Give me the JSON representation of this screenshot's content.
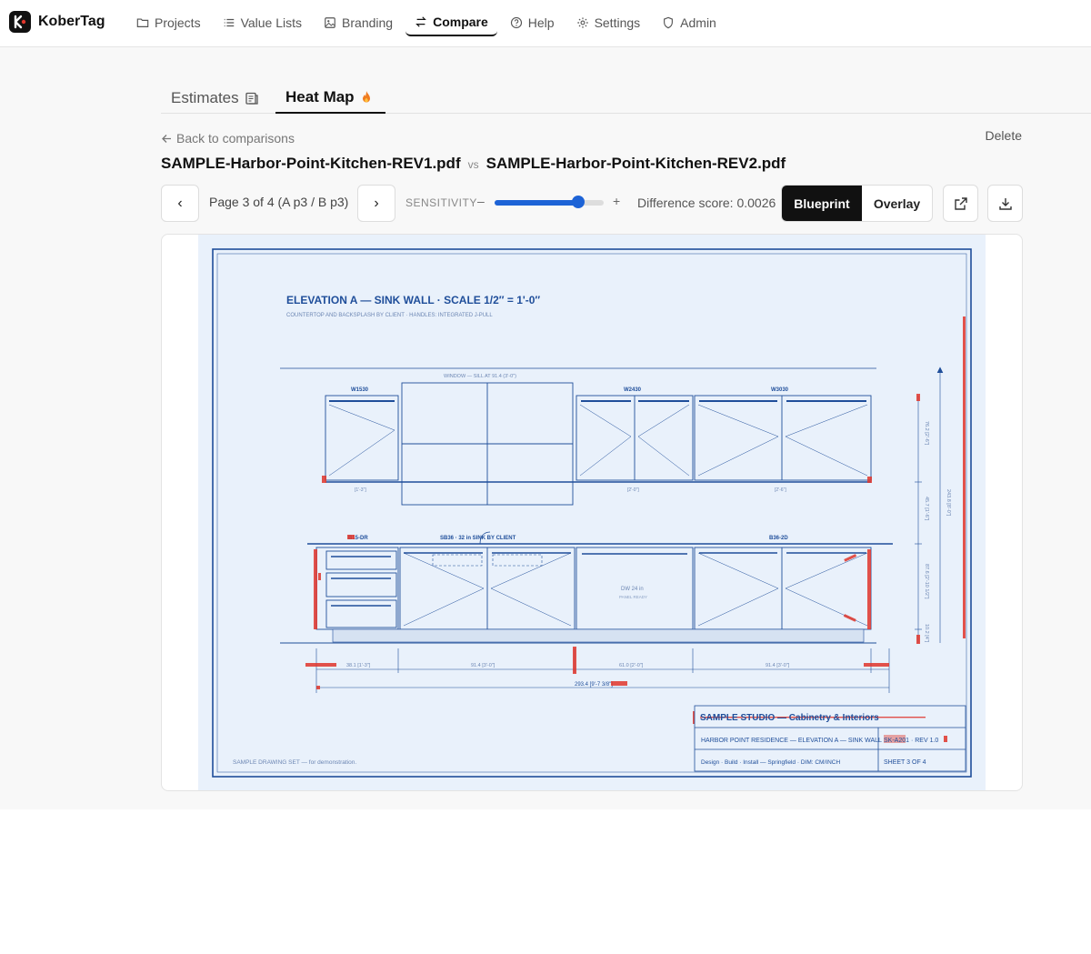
{
  "app": {
    "name": "KoberTag"
  },
  "nav": [
    {
      "label": "Projects",
      "icon": "folder-icon"
    },
    {
      "label": "Value Lists",
      "icon": "list-icon"
    },
    {
      "label": "Branding",
      "icon": "image-icon"
    },
    {
      "label": "Compare",
      "icon": "compare-arrows-icon",
      "active": true
    },
    {
      "label": "Help",
      "icon": "help-circle-icon"
    },
    {
      "label": "Settings",
      "icon": "gear-icon"
    },
    {
      "label": "Admin",
      "icon": "shield-icon"
    }
  ],
  "tabs": {
    "estimates": {
      "label": "Estimates",
      "icon": "document-icon"
    },
    "heatmap": {
      "label": "Heat Map",
      "icon": "flame-icon",
      "active": true
    }
  },
  "header": {
    "back_label": "Back to comparisons",
    "delete_label": "Delete",
    "file_a": "SAMPLE-Harbor-Point-Kitchen-REV1.pdf",
    "vs": "vs",
    "file_b": "SAMPLE-Harbor-Point-Kitchen-REV2.pdf"
  },
  "controls": {
    "prev_label": "‹",
    "next_label": "›",
    "page_label": "Page 3 of 4 (A p3 / B p3)",
    "sensitivity_label": "SENSITIVITY",
    "sensitivity_minus": "–",
    "sensitivity_plus": "+",
    "sensitivity_level": 0.77,
    "difference_label": "Difference score: 0.0026",
    "mode_blueprint": "Blueprint",
    "mode_overlay": "Overlay",
    "mode_selected": "Blueprint"
  },
  "drawing": {
    "title": "ELEVATION A — SINK WALL · SCALE 1/2″ = 1'-0″",
    "subtitle": "COUNTERTOP AND BACKSPLASH BY CLIENT · HANDLES: INTEGRATED J-PULL",
    "window_label": "WINDOW — SILL AT 91.4 (3'-0\")",
    "upper_labels": [
      "W1530",
      "W2430",
      "W3030"
    ],
    "lower_labels": [
      "B15-DR",
      "SB36 · 32 in SINK BY CLIENT",
      "B36-2D"
    ],
    "dw_label": "DW 24 in",
    "dw_sub": "PANEL READY",
    "upper_sizes": [
      "[1'-3\"]",
      "[2'-0\"]",
      "[2'-6\"]"
    ],
    "dims": [
      "38.1 [1'-3\"]",
      "91.4 [3'-0\"]",
      "61.0 [2'-0\"]",
      "91.4 [3'-0\"]"
    ],
    "overall_dim": "293.4 [9'-7 3/8\"]",
    "vertical_dims": [
      "76.2 [2'-6\"]",
      "45.7 [1'-6\"]",
      "87.6 [2'-10 1/2\"]",
      "10.2 [4\"]",
      "243.8 [8'-0\"]"
    ],
    "studio": "SAMPLE STUDIO — Cabinetry & Interiors",
    "project_line": "HARBOR POINT RESIDENCE — ELEVATION A — SINK WALL",
    "sheet_code": "SK-A201 · REV 1.0",
    "footer_line": "Design · Build · Install — Springfield · DIM: CM/INCH",
    "sheet_num": "SHEET 3 OF 4",
    "disclaimer": "SAMPLE DRAWING SET — for demonstration."
  },
  "colors": {
    "accent": "#1d63d6",
    "ink": "#1f4e9a",
    "diff": "#e0362c"
  }
}
